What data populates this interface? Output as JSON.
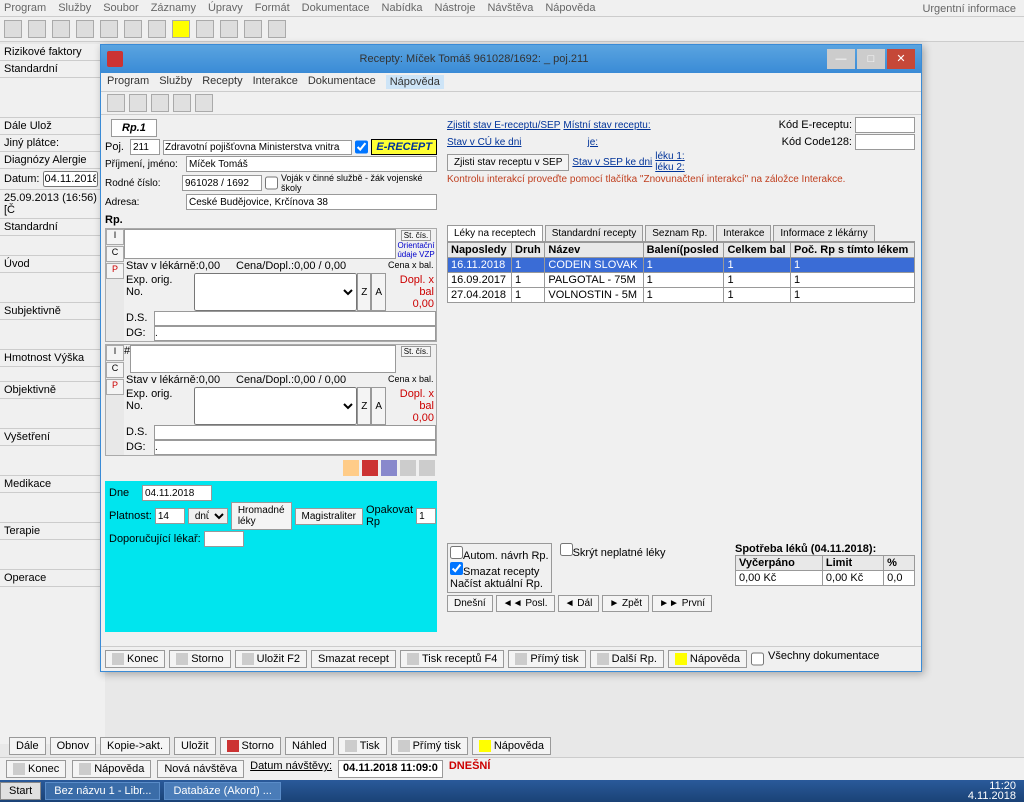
{
  "app": {
    "menus": [
      "Program",
      "Služby",
      "Soubor",
      "Záznamy",
      "Úpravy",
      "Formát",
      "Dokumentace",
      "Nabídka",
      "Nástroje",
      "Návštěva",
      "Nápověda"
    ],
    "urgent": "Urgentní informace"
  },
  "side": {
    "risk_tab": "Rizikové faktory",
    "standard": "Standardní",
    "dale": "Dále",
    "uloz": "Ulož",
    "jiny": "Jiný plátce:",
    "diag_tab": "Diagnózy",
    "alerg_tab": "Alergie",
    "datum_lbl": "Datum:",
    "datum_val": "04.11.2018",
    "ts": "25.09.2013 (16:56) [Č",
    "standard2": "Standardní",
    "uvod": "Úvod",
    "subj": "Subjektivně",
    "hmot": "Hmotnost Výška",
    "obj": "Objektivně",
    "vys": "Vyšetření",
    "med": "Medikace",
    "ter": "Terapie",
    "oper": "Operace"
  },
  "dialog": {
    "title": "Recepty: Míček Tomáš 961028/1692: _ poj.211",
    "menus": [
      "Program",
      "Služby",
      "Recepty",
      "Interakce",
      "Dokumentace",
      "Nápověda"
    ],
    "rp_tab": "Rp.1",
    "poj_lbl": "Poj.",
    "poj_val": "211",
    "poj_name": "Zdravotní pojišťovna Ministerstva vnitra",
    "erecept": "E-RECEPT",
    "prijmeni_lbl": "Příjmení, jméno:",
    "prijmeni_val": "Míček Tomáš",
    "rc_lbl": "Rodné číslo:",
    "rc_val": "961028 / 1692",
    "vojak": "Voják v činné službě - žák vojenské školy",
    "adresa_lbl": "Adresa:",
    "adresa_val": "České Budějovice, Krčínova 38",
    "rp_head": "Rp.",
    "stcis": "St. čís.",
    "orient": "Orientační údaje VZP",
    "stav_lek": "Stav v lékárně:0,00",
    "cena_dopl": "Cena/Dopl.:0,00 / 0,00",
    "cena_bal": "Cena x bal.",
    "exp": "Exp. orig. No.",
    "ds": "D.S.",
    "dg": "DG:",
    "doplxbal": "Dopl. x bal",
    "zero": "0,00",
    "dne_lbl": "Dne",
    "dne_val": "04.11.2018",
    "platnost_lbl": "Platnost:",
    "platnost_val": "14",
    "platnost_unit": "dnů",
    "hromadne": "Hromadné léky",
    "magistr": "Magistraliter",
    "opakovat": "Opakovat Rp",
    "opakovat_val": "1",
    "dopor": "Doporučující lékař:"
  },
  "right": {
    "zjistit_sep": "Zjistit stav E-receptu/SEP",
    "mistni": "Místní stav receptu:",
    "stav_cu": "Stav v CÚ ke dni",
    "je": "je:",
    "zjisti_rec": "Zjisti stav receptu v SEP",
    "stav_sep": "Stav v SEP ke dni",
    "leku1": "léku 1:",
    "leku2": "léku 2:",
    "kod_er": "Kód E-receptu:",
    "kod_128": "Kód Code128:",
    "warn": "Kontrolu interakcí proveďte pomocí tlačítka \"Znovunačtení interakcí\" na záložce Interakce.",
    "tabs": [
      "Léky na receptech",
      "Standardní recepty",
      "Seznam Rp.",
      "Interakce",
      "Informace z lékárny"
    ],
    "cols": [
      "Naposledy",
      "Druh",
      "Název",
      "Balení(posled",
      "Celkem bal",
      "Poč. Rp s tímto lékem"
    ],
    "rows": [
      {
        "d": "16.11.2018",
        "r": "1",
        "n": "CODEIN SLOVAK",
        "b": "1",
        "c": "1",
        "p": "1"
      },
      {
        "d": "16.09.2017",
        "r": "1",
        "n": "PALGOTAL - 75M",
        "b": "1",
        "c": "1",
        "p": "1"
      },
      {
        "d": "27.04.2018",
        "r": "1",
        "n": "VOLNOSTIN - 5M",
        "b": "1",
        "c": "1",
        "p": "1"
      }
    ],
    "autom": "Autom. návrh Rp.",
    "smazat": "Smazat recepty",
    "nacist": "Načíst aktuální Rp.",
    "skryt": "Skrýt neplatné léky",
    "spotreba": "Spotřeba léků (04.11.2018):",
    "vycerpano": "Vyčerpáno",
    "limit": "Limit",
    "pct": "%",
    "vyc_val": "0,00 Kč",
    "lim_val": "0,00 Kč",
    "pct_val": "0,0",
    "nav": {
      "dnesni": "Dnešní",
      "posl": "◄◄ Posl.",
      "dal": "◄ Dál",
      "zpet": "► Zpět",
      "prvni": "►► První"
    }
  },
  "dbtns": {
    "konec": "Konec",
    "storno": "Storno",
    "ulozit": "Uložit  F2",
    "smazat": "Smazat recept",
    "tisk": "Tisk receptů F4",
    "primy": "Přímý tisk",
    "dalsi": "Další Rp.",
    "napoveda": "Nápověda",
    "vsechny": "Všechny dokumentace"
  },
  "bottom": {
    "dale": "Dále",
    "obnov": "Obnov",
    "kopie": "Kopie->akt.",
    "ulozit": "Uložit",
    "storno": "Storno",
    "nahled": "Náhled",
    "tisk": "Tisk",
    "primy": "Přímý tisk",
    "napoveda": "Nápověda"
  },
  "status": {
    "konec": "Konec",
    "napoveda": "Nápověda",
    "nova": "Nová návštěva",
    "datum_lbl": "Datum návštěvy:",
    "datum_val": "04.11.2018 11:09:0",
    "dnesni": "DNEŠNÍ"
  },
  "taskbar": {
    "start": "Start",
    "t1": "Bez názvu 1 - Libr...",
    "t2": "Databáze (Akord) ...",
    "time": "11:20",
    "date": "4.11.2018"
  }
}
